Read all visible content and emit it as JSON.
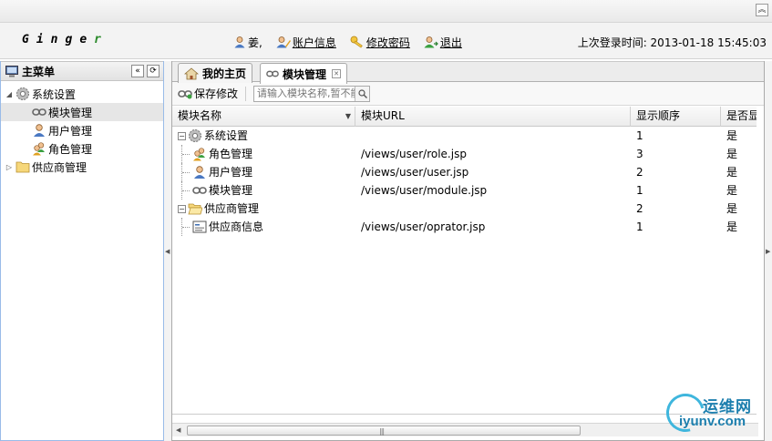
{
  "topbar": {
    "collapse_icon": "double-chevron-up-icon"
  },
  "header": {
    "logo_letters": [
      "G",
      "i",
      "n",
      "g",
      "e",
      "r"
    ],
    "user_name": "姜,",
    "account_info": "账户信息",
    "change_password": "修改密码",
    "logout": "退出",
    "last_login": "上次登录时间: 2013-01-18 15:45:03"
  },
  "sidebar": {
    "title": "主菜单",
    "items": [
      {
        "label": "系统设置",
        "icon": "gear-icon",
        "level": 0,
        "expanded": true
      },
      {
        "label": "模块管理",
        "icon": "link-icon",
        "level": 1,
        "selected": true
      },
      {
        "label": "用户管理",
        "icon": "user-icon",
        "level": 1
      },
      {
        "label": "角色管理",
        "icon": "role-icon",
        "level": 1
      },
      {
        "label": "供应商管理",
        "icon": "folder-icon",
        "level": 0,
        "expanded": false
      }
    ]
  },
  "tabs": [
    {
      "label": "我的主页",
      "icon": "home-icon",
      "active": false
    },
    {
      "label": "模块管理",
      "icon": "link-icon",
      "active": true,
      "closable": true
    }
  ],
  "toolbar": {
    "save_label": "保存修改",
    "search_placeholder": "请输入模块名称,暂不能"
  },
  "grid": {
    "columns": [
      "模块名称",
      "模块URL",
      "显示顺序",
      "是否显"
    ],
    "rows": [
      {
        "name": "系统设置",
        "icon": "gear-icon",
        "level": 0,
        "url": "",
        "order": "1",
        "show": "是"
      },
      {
        "name": "角色管理",
        "icon": "role-icon",
        "level": 1,
        "url": "/views/user/role.jsp",
        "order": "3",
        "show": "是"
      },
      {
        "name": "用户管理",
        "icon": "user-icon",
        "level": 1,
        "url": "/views/user/user.jsp",
        "order": "2",
        "show": "是"
      },
      {
        "name": "模块管理",
        "icon": "link-icon",
        "level": 1,
        "url": "/views/user/module.jsp",
        "order": "1",
        "show": "是"
      },
      {
        "name": "供应商管理",
        "icon": "folder-open-icon",
        "level": 0,
        "url": "",
        "order": "2",
        "show": "是"
      },
      {
        "name": "供应商信息",
        "icon": "form-icon",
        "level": 1,
        "url": "/views/user/oprator.jsp",
        "order": "1",
        "show": "是"
      }
    ]
  },
  "watermark": {
    "cn": "运维网",
    "en": "iyunv.com"
  },
  "colors": {
    "accent_blue": "#99bbe8",
    "watermark": "#1d7fae"
  }
}
